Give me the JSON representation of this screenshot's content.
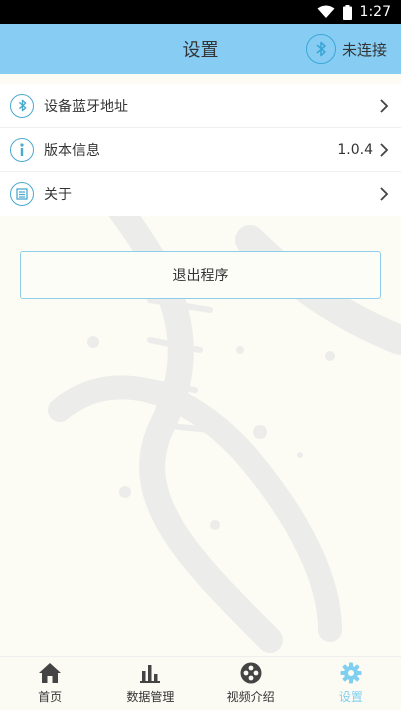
{
  "status_bar": {
    "time": "1:27"
  },
  "header": {
    "title": "设置",
    "connection_status": "未连接"
  },
  "settings": {
    "items": [
      {
        "label": "设备蓝牙地址",
        "value": "",
        "icon": "bluetooth-icon"
      },
      {
        "label": "版本信息",
        "value": "1.0.4",
        "icon": "info-icon"
      },
      {
        "label": "关于",
        "value": "",
        "icon": "about-icon"
      }
    ]
  },
  "exit_button": {
    "label": "退出程序"
  },
  "tabbar": {
    "tabs": [
      {
        "label": "首页",
        "icon": "home-icon"
      },
      {
        "label": "数据管理",
        "icon": "chart-icon"
      },
      {
        "label": "视频介绍",
        "icon": "video-icon"
      },
      {
        "label": "设置",
        "icon": "settings-icon",
        "active": true
      }
    ]
  },
  "colors": {
    "header": "#87cdf3",
    "accent": "#7fcff0",
    "icon": "#4aa9cf"
  }
}
